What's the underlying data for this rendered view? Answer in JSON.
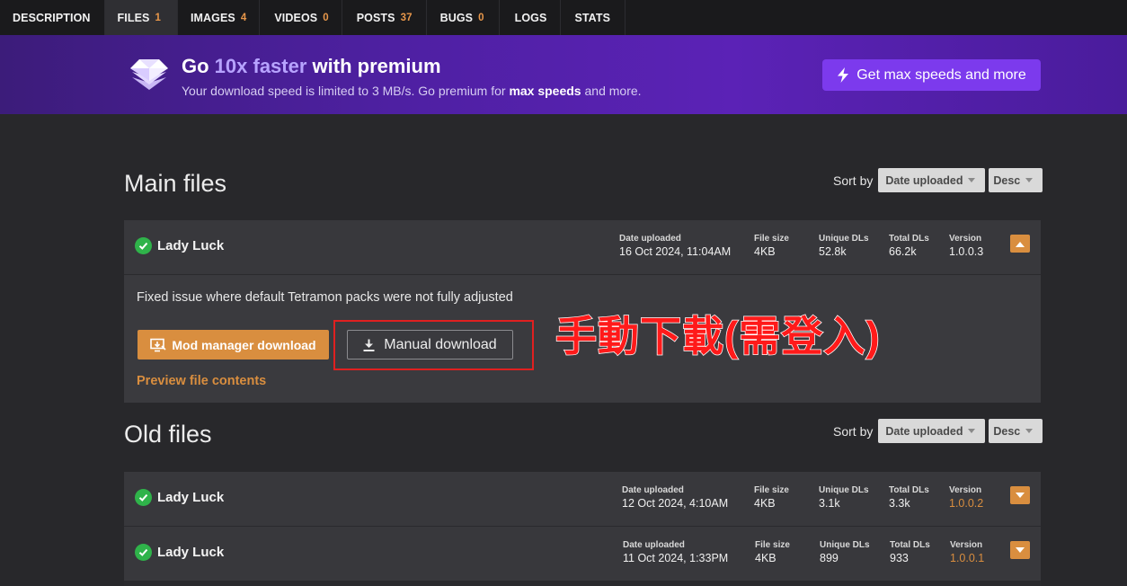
{
  "tabs": [
    {
      "label": "DESCRIPTION",
      "count": ""
    },
    {
      "label": "FILES",
      "count": "1"
    },
    {
      "label": "IMAGES",
      "count": "4"
    },
    {
      "label": "VIDEOS",
      "count": "0"
    },
    {
      "label": "POSTS",
      "count": "37"
    },
    {
      "label": "BUGS",
      "count": "0"
    },
    {
      "label": "LOGS",
      "count": ""
    },
    {
      "label": "STATS",
      "count": ""
    }
  ],
  "banner": {
    "headline_pre": "Go ",
    "headline_highlight": "10x faster",
    "headline_post": " with premium",
    "sub_pre": "Your download speed is limited to 3 MB/s. Go premium for ",
    "sub_bold": "max speeds",
    "sub_post": " and more.",
    "cta_label": "Get max speeds and more"
  },
  "sort": {
    "label": "Sort by",
    "field": "Date uploaded",
    "order": "Desc"
  },
  "main_files": {
    "title": "Main files",
    "files": [
      {
        "name": "Lady Luck",
        "date_label": "Date uploaded",
        "date": "16 Oct 2024, 11:04AM",
        "size_label": "File size",
        "size": "4KB",
        "unique_label": "Unique DLs",
        "unique": "52.8k",
        "total_label": "Total DLs",
        "total": "66.2k",
        "version_label": "Version",
        "version": "1.0.0.3",
        "description": "Fixed issue where default Tetramon packs were not fully adjusted",
        "mod_manager_label": "Mod manager download",
        "manual_label": "Manual download",
        "preview_label": "Preview file contents"
      }
    ]
  },
  "old_files": {
    "title": "Old files",
    "files": [
      {
        "name": "Lady Luck",
        "date_label": "Date uploaded",
        "date": "12 Oct 2024, 4:10AM",
        "size_label": "File size",
        "size": "4KB",
        "unique_label": "Unique DLs",
        "unique": "3.1k",
        "total_label": "Total DLs",
        "total": "3.3k",
        "version_label": "Version",
        "version": "1.0.0.2"
      },
      {
        "name": "Lady Luck",
        "date_label": "Date uploaded",
        "date": "11 Oct 2024, 1:33PM",
        "size_label": "File size",
        "size": "4KB",
        "unique_label": "Unique DLs",
        "unique": "899",
        "total_label": "Total DLs",
        "total": "933",
        "version_label": "Version",
        "version": "1.0.0.1"
      }
    ]
  },
  "annotation": "手動下載(需登入)",
  "icons": {
    "premium": "diamond-icon",
    "cta": "lightning-icon",
    "verified": "check-circle-icon",
    "collapse": "chevron-up-icon",
    "expand": "chevron-down-icon",
    "mod_manager": "monitor-download-icon",
    "manual": "download-icon"
  },
  "colors": {
    "accent_orange": "#d98e3f",
    "premium_purple": "#7c3aed",
    "annotation_red": "#ff1a1a"
  }
}
